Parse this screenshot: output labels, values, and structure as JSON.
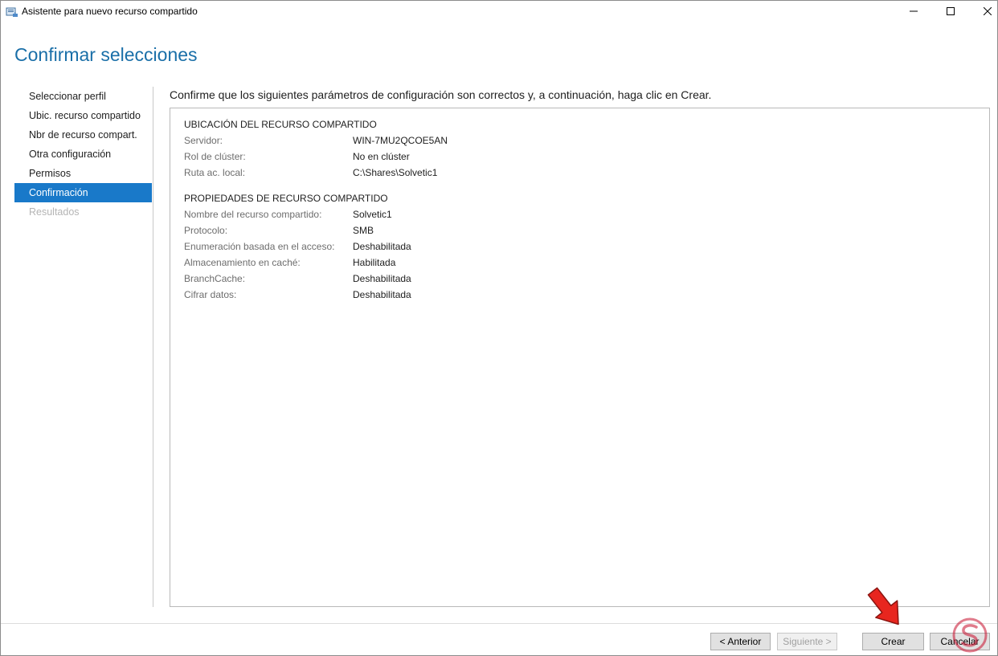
{
  "window": {
    "title": "Asistente para nuevo recurso compartido"
  },
  "header": {
    "title": "Confirmar selecciones"
  },
  "nav": {
    "items": [
      {
        "label": "Seleccionar perfil",
        "state": "normal"
      },
      {
        "label": "Ubic. recurso compartido",
        "state": "normal"
      },
      {
        "label": "Nbr de recurso compart.",
        "state": "normal"
      },
      {
        "label": "Otra configuración",
        "state": "normal"
      },
      {
        "label": "Permisos",
        "state": "normal"
      },
      {
        "label": "Confirmación",
        "state": "active"
      },
      {
        "label": "Resultados",
        "state": "disabled"
      }
    ]
  },
  "content": {
    "instruction": "Confirme que los siguientes parámetros de configuración son correctos y, a continuación, haga clic en Crear.",
    "location": {
      "heading": "UBICACIÓN DEL RECURSO COMPARTIDO",
      "rows": [
        {
          "label": "Servidor:",
          "value": "WIN-7MU2QCOE5AN"
        },
        {
          "label": "Rol de clúster:",
          "value": "No en clúster"
        },
        {
          "label": "Ruta ac. local:",
          "value": "C:\\Shares\\Solvetic1"
        }
      ]
    },
    "properties": {
      "heading": "PROPIEDADES DE RECURSO COMPARTIDO",
      "rows": [
        {
          "label": "Nombre del recurso compartido:",
          "value": "Solvetic1"
        },
        {
          "label": "Protocolo:",
          "value": "SMB"
        },
        {
          "label": "Enumeración basada en el acceso:",
          "value": "Deshabilitada"
        },
        {
          "label": "Almacenamiento en caché:",
          "value": "Habilitada"
        },
        {
          "label": "BranchCache:",
          "value": "Deshabilitada"
        },
        {
          "label": "Cifrar datos:",
          "value": "Deshabilitada"
        }
      ]
    }
  },
  "footer": {
    "prev_label": "< Anterior",
    "next_label": "Siguiente >",
    "create_label": "Crear",
    "cancel_label": "Cancelar"
  },
  "icons": {
    "app": "share-wizard-icon",
    "minimize": "minimize-icon",
    "maximize": "maximize-icon",
    "close": "close-icon",
    "annotation": "red-arrow-icon"
  },
  "colors": {
    "accent": "#1979c9",
    "title": "#1a6fa8",
    "arrow": "#e8261f"
  }
}
